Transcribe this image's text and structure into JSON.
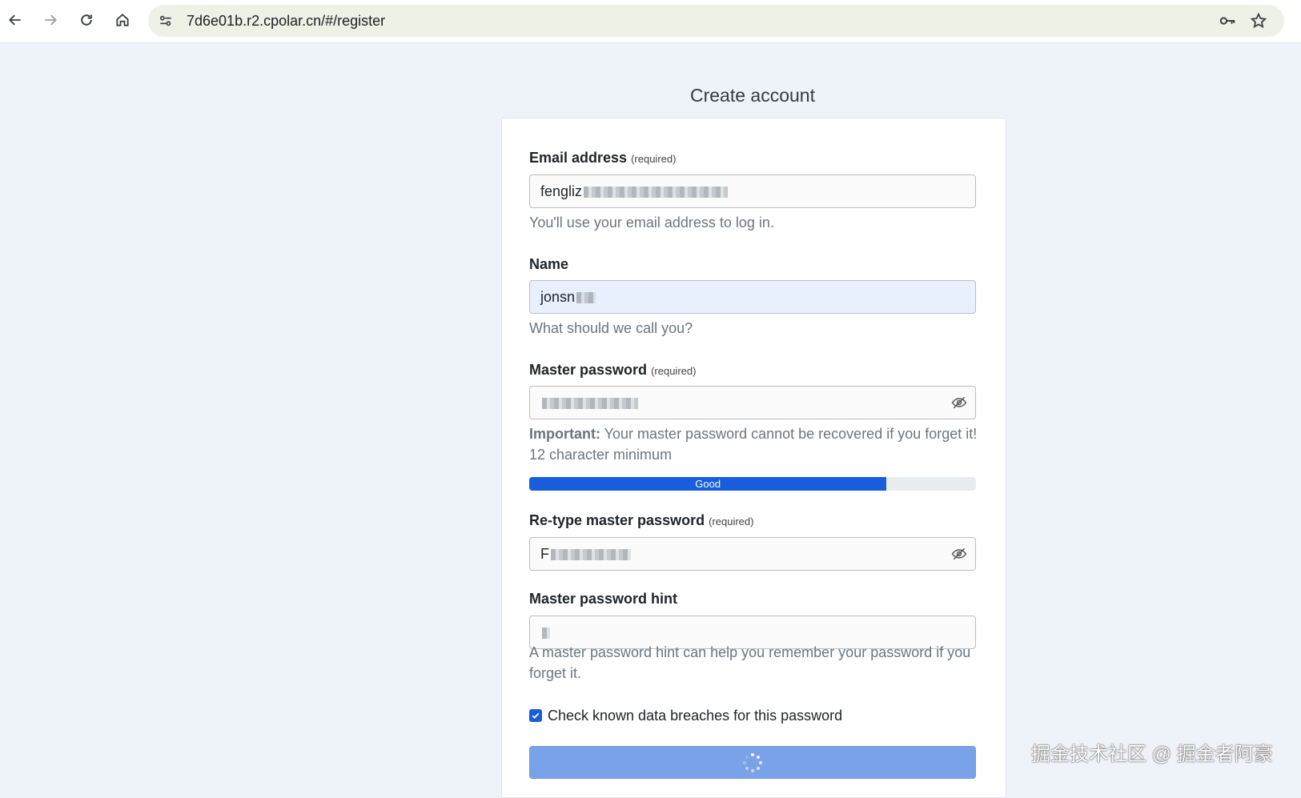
{
  "browser": {
    "url": "7d6e01b.r2.cpolar.cn/#/register"
  },
  "page": {
    "title": "Create account"
  },
  "form": {
    "email": {
      "label": "Email address",
      "required": "(required)",
      "value": "fengliz",
      "help": "You'll use your email address to log in."
    },
    "name": {
      "label": "Name",
      "value": "jonsn",
      "help": "What should we call you?"
    },
    "master_password": {
      "label": "Master password",
      "required": "(required)",
      "help_bold": "Important:",
      "help": " Your master password cannot be recovered if you forget it! 12 character minimum"
    },
    "strength": {
      "label": "Good",
      "fraction": 0.8
    },
    "retype_password": {
      "label": "Re-type master password",
      "required": "(required)",
      "value": "F"
    },
    "hint": {
      "label": "Master password hint",
      "help": "A master password hint can help you remember your password if you forget it."
    },
    "breach_check": {
      "label": "Check known data breaches for this password",
      "checked": true
    }
  },
  "watermark": "掘金技术社区 @ 掘金者阿豪",
  "colors": {
    "primary": "#175ddc",
    "submit_loading": "#7aa2e8",
    "autofill": "#e8f0fe"
  }
}
